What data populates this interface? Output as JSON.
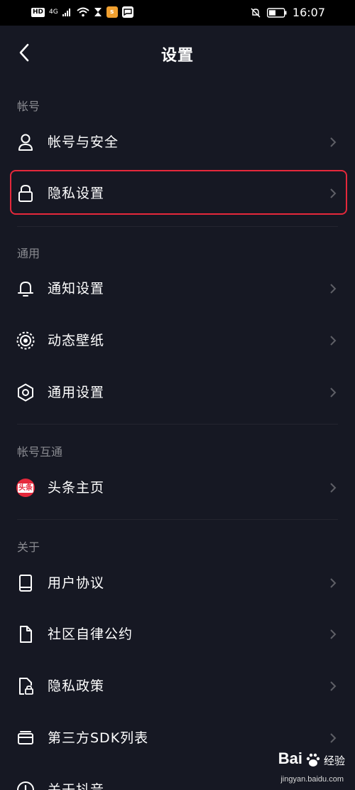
{
  "status_bar": {
    "hd_label": "HD",
    "network": "4G",
    "time": "16:07"
  },
  "header": {
    "title": "设置"
  },
  "sections": {
    "account": {
      "label": "帐号",
      "items": [
        {
          "label": "帐号与安全"
        },
        {
          "label": "隐私设置",
          "highlighted": true
        }
      ]
    },
    "general": {
      "label": "通用",
      "items": [
        {
          "label": "通知设置"
        },
        {
          "label": "动态壁纸"
        },
        {
          "label": "通用设置"
        }
      ]
    },
    "linked": {
      "label": "帐号互通",
      "items": [
        {
          "label": "头条主页",
          "badge_text": "头条"
        }
      ]
    },
    "about": {
      "label": "关于",
      "items": [
        {
          "label": "用户协议"
        },
        {
          "label": "社区自律公约"
        },
        {
          "label": "隐私政策"
        },
        {
          "label": "第三方SDK列表"
        },
        {
          "label": "关于抖音"
        }
      ]
    }
  },
  "watermark": {
    "brand": "Bai",
    "brand_suffix": "经验",
    "url": "jingyan.baidu.com"
  },
  "colors": {
    "background": "#161823",
    "highlight_border": "#e5283b",
    "section_label": "#8a8b91",
    "chevron": "#5e5f66"
  }
}
